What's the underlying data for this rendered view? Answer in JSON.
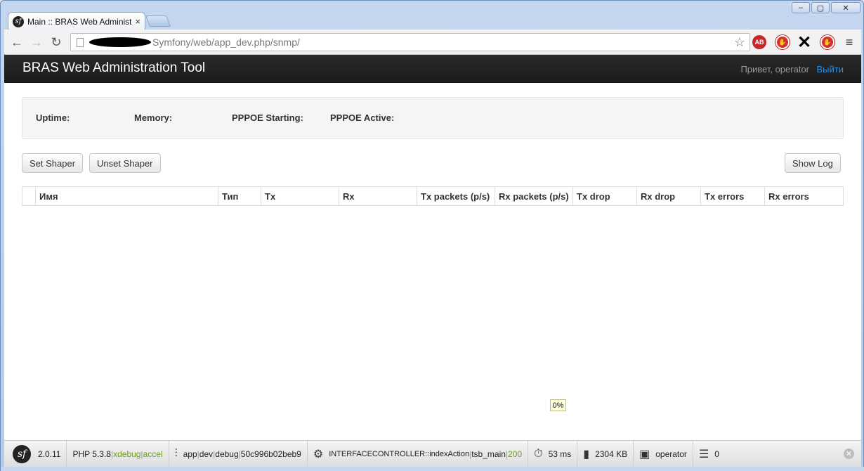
{
  "browser": {
    "tab_title": "Main :: BRAS Web Administra",
    "tab_close": "×",
    "url_visible": "Symfony/web/app_dev.php/snmp/",
    "window_buttons": [
      "–",
      "▢",
      "✕"
    ],
    "extensions": [
      "adblock-plus-icon",
      "stop-icon",
      "x-icon",
      "stop-icon",
      "menu-icon"
    ]
  },
  "app": {
    "brand": "BRAS Web Administration Tool",
    "greeting": "Привет, operator",
    "logout": "Выйти"
  },
  "stats": {
    "uptime": "Uptime:",
    "memory": "Memory:",
    "pppoe_starting": "PPPOE Starting:",
    "pppoe_active": "PPPOE Active:"
  },
  "actions": {
    "set_shaper": "Set Shaper",
    "unset_shaper": "Unset Shaper",
    "show_log": "Show Log"
  },
  "table": {
    "columns": [
      "",
      "Имя",
      "Тип",
      "Tx",
      "Rx",
      "Tx packets (p/s)",
      "Rx packets (p/s)",
      "Tx drop",
      "Rx drop",
      "Tx errors",
      "Rx errors"
    ]
  },
  "progress": {
    "label": "0%",
    "value": 0
  },
  "debug_toolbar": {
    "version": "2.0.11",
    "php_label": "PHP 5.3.8",
    "php_ext_1": "xdebug",
    "php_ext_2": "accel",
    "config_1": "app",
    "config_2": "dev",
    "config_3": "debug",
    "config_4": "50c996b02beb9",
    "controller": "INTERFACECONTROLLER::indexAction",
    "route": "tsb_main",
    "status": "200",
    "time": "53 ms",
    "memory": "2304 KB",
    "user": "operator",
    "queries": "0"
  },
  "colors": {
    "appbar": "#1a1a1a",
    "logout_link": "#2f8ee0",
    "status_green": "#6a9e1b"
  }
}
